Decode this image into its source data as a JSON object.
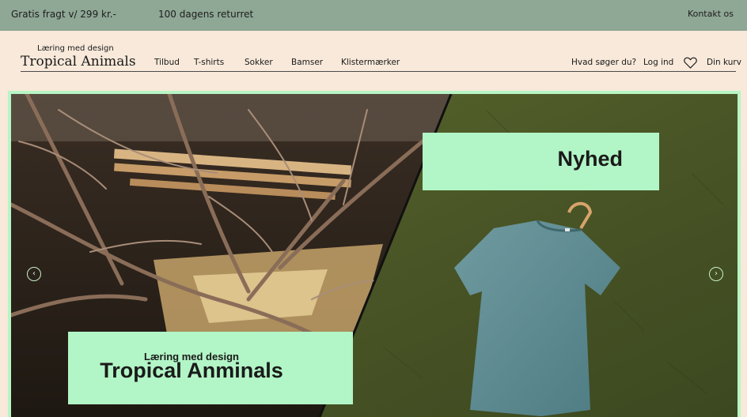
{
  "topbar": {
    "shipping": "Gratis fragt v/ 299 kr.-",
    "returns": "100 dagens returret",
    "contact": "Kontakt os"
  },
  "logo": {
    "subtitle": "Læring med design",
    "title": "Tropical Animals"
  },
  "nav": {
    "items": [
      "Tilbud",
      "T-shirts",
      "Sokker",
      "Bamser",
      "Klistermærker"
    ]
  },
  "header_right": {
    "search": "Hvad søger du?",
    "login": "Log ind",
    "wishlist_icon": "heart-icon",
    "cart": "Din kurv"
  },
  "hero": {
    "new_label": "Nyhed",
    "brand_subtitle": "Læring med design",
    "brand_title": "Tropical Anminals",
    "prev_icon": "chevron-left-icon",
    "next_icon": "chevron-right-icon"
  },
  "colors": {
    "topbar_bg": "#8fa795",
    "page_bg": "#f8e9da",
    "accent_green": "#b2f5c6"
  }
}
